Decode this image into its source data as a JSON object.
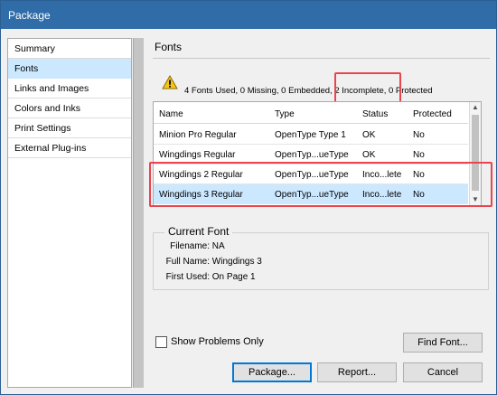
{
  "window": {
    "title": "Package"
  },
  "sidebar": {
    "items": [
      {
        "label": "Summary"
      },
      {
        "label": "Fonts"
      },
      {
        "label": "Links and Images"
      },
      {
        "label": "Colors and Inks"
      },
      {
        "label": "Print Settings"
      },
      {
        "label": "External Plug-ins"
      }
    ],
    "selected": "Fonts"
  },
  "fonts": {
    "section_title": "Fonts",
    "summary": "4 Fonts Used, 0 Missing, 0 Embedded, 2 Incomplete, 0 Protected",
    "columns": [
      "Name",
      "Type",
      "Status",
      "Protected"
    ],
    "rows": [
      {
        "name": "Minion Pro Regular",
        "type": "OpenType Type 1",
        "status": "OK",
        "protected": "No"
      },
      {
        "name": "Wingdings Regular",
        "type": "OpenTyp...ueType",
        "status": "OK",
        "protected": "No"
      },
      {
        "name": "Wingdings 2 Regular",
        "type": "OpenTyp...ueType",
        "status": "Inco...lete",
        "protected": "No"
      },
      {
        "name": "Wingdings 3 Regular",
        "type": "OpenTyp...ueType",
        "status": "Inco...lete",
        "protected": "No"
      }
    ],
    "selected_row": "Wingdings 3 Regular"
  },
  "current_font": {
    "title": "Current Font",
    "filename_label": "Filename:",
    "filename_value": "NA",
    "fullname_label": "Full Name:",
    "fullname_value": "Wingdings 3",
    "firstused_label": "First Used:",
    "firstused_value": "On Page 1"
  },
  "options": {
    "show_problems_label": "Show Problems Only",
    "show_problems_checked": false
  },
  "buttons": {
    "find_font": "Find Font...",
    "package": "Package...",
    "report": "Report...",
    "cancel": "Cancel"
  },
  "colors": {
    "titlebar": "#2f6ca8",
    "selection": "#cce8ff",
    "highlight_box": "#e8454f",
    "warning": "#f5c518"
  },
  "icons": {
    "warning": "warning-triangle-icon"
  }
}
